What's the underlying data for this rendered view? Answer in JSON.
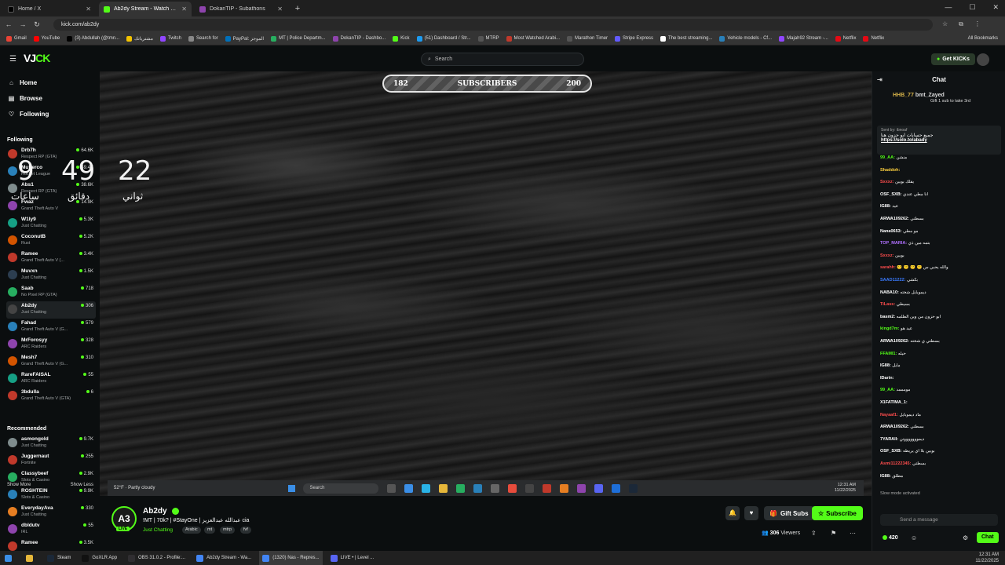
{
  "browser": {
    "tabs": [
      {
        "label": "Home / X",
        "color": "#000000"
      },
      {
        "label": "Ab2dy Stream - Watch Live on",
        "color": "#53fc18"
      },
      {
        "label": "DokanTIP - Subathons",
        "color": "#8e44ad"
      }
    ],
    "url": "kick.com/ab2dy",
    "bookmarks": [
      "Gmail",
      "YouTube",
      "(3) Abdullah (@tmn...",
      "مشترياتك",
      "Twitch",
      "Search for",
      "PayPal: الموجز",
      "MT | Police Departm...",
      "DokanTIP - Dashbo...",
      "Kick",
      "(51) Dashboard / Str...",
      "MTRP",
      "Most Watched Arabi...",
      "Marathon Timer",
      "Stripe Express",
      "The best streaming...",
      "Vehicle models - Cf...",
      "Majah92 Stream -...",
      "Netflix",
      "Netflix"
    ],
    "all_bookmarks": "All Bookmarks"
  },
  "header": {
    "search_placeholder": "Search",
    "get_kicks": "Get KICKs"
  },
  "sidebar": {
    "nav": [
      "Home",
      "Browse",
      "Following"
    ],
    "following_title": "Following",
    "following": [
      {
        "name": "Drb7h",
        "cat": "Respect RP (GTA)",
        "viewers": "64.6K",
        "color": "#c0392b"
      },
      {
        "name": "Mufierco",
        "cat": "Rocket League",
        "viewers": "49.4K",
        "color": "#2980b9"
      },
      {
        "name": "Abs1",
        "cat": "Respect RP (GTA)",
        "viewers": "38.6K",
        "color": "#7f8c8d"
      },
      {
        "name": "Fwaz",
        "cat": "Grand Theft Auto V",
        "viewers": "14.9K",
        "color": "#8e44ad"
      },
      {
        "name": "W1ly9",
        "cat": "Just Chatting",
        "viewers": "5.3K",
        "color": "#16a085"
      },
      {
        "name": "CoconutB",
        "cat": "Rust",
        "viewers": "5.2K",
        "color": "#d35400"
      },
      {
        "name": "Ramee",
        "cat": "Grand Theft Auto V (...",
        "viewers": "3.4K",
        "color": "#c0392b"
      },
      {
        "name": "Muvxn",
        "cat": "Just Chatting",
        "viewers": "1.5K",
        "color": "#2c3e50"
      },
      {
        "name": "Saab",
        "cat": "No Pixel RP (GTA)",
        "viewers": "718",
        "color": "#27ae60"
      },
      {
        "name": "Ab2dy",
        "cat": "Just Chatting",
        "viewers": "306",
        "color": "#444444"
      },
      {
        "name": "Fahad",
        "cat": "Grand Theft Auto V (G...",
        "viewers": "579",
        "color": "#2980b9"
      },
      {
        "name": "MrForosyy",
        "cat": "ARC Raiders",
        "viewers": "328",
        "color": "#8e44ad"
      },
      {
        "name": "Mesh7",
        "cat": "Grand Theft Auto V (G...",
        "viewers": "310",
        "color": "#d35400"
      },
      {
        "name": "RareFAISAL",
        "cat": "ARC Raiders",
        "viewers": "55",
        "color": "#16a085"
      },
      {
        "name": "3bdulla",
        "cat": "Grand Theft Auto V (GTA)",
        "viewers": "6",
        "color": "#c0392b"
      }
    ],
    "show_more": "Show More",
    "show_less": "Show Less",
    "recommended_title": "Recommended",
    "recommended": [
      {
        "name": "asmongold",
        "cat": "Just Chatting",
        "viewers": "9.7K",
        "color": "#7f8c8d"
      },
      {
        "name": "Juggernaut",
        "cat": "Fortnite",
        "viewers": "255",
        "color": "#c0392b"
      },
      {
        "name": "Classybeef",
        "cat": "Slots & Casino",
        "viewers": "2.9K",
        "color": "#27ae60"
      },
      {
        "name": "ROSHTEIN",
        "cat": "Slots & Casino",
        "viewers": "9.9K",
        "color": "#2980b9"
      },
      {
        "name": "EverydayAva",
        "cat": "Just Chatting",
        "viewers": "330",
        "color": "#e67e22"
      },
      {
        "name": "dbldutv",
        "cat": "IRL",
        "viewers": "55",
        "color": "#8e44ad"
      },
      {
        "name": "Ramee",
        "cat": "",
        "viewers": "3.5K",
        "color": "#c0392b"
      }
    ]
  },
  "stream": {
    "sub_goal": {
      "current": "182",
      "label": "SUBSCRIBERS",
      "target": "200",
      "progress": 0.91
    },
    "timer": {
      "hours": "9",
      "hours_label": "ساعات",
      "minutes": "49",
      "minutes_label": "دقائق",
      "seconds": "22",
      "seconds_label": "ثواني"
    },
    "weather": "Partly cloudy",
    "temp": "52°F",
    "embedded_search": "Search",
    "embedded_time": "12:31 AM",
    "embedded_date": "11/22/2025",
    "streamer": "Ab2dy",
    "title": "!MT | 70k? | #StayOne | عبدالله عبدالعزيز cia",
    "category": "Just Chatting",
    "tags": [
      "Arabic",
      "mt",
      "mtrp",
      "fvf"
    ],
    "live_label": "LIVE",
    "gift_subs": "Gift Subs",
    "subscribe": "Subscribe",
    "viewers": "306",
    "viewers_label": "Viewers"
  },
  "chat": {
    "title": "Chat",
    "top_gifter_1": "HHB_77",
    "top_gifter_2": "bmt_Zayed",
    "gift_note": "Gift 1 sub to take 3rd",
    "pinned_by": "Sent by: ibnoaf",
    "pinned_text": "جميع حسابات ابو حزون هنا",
    "pinned_link": "https://solo.to/abady",
    "messages": [
      {
        "u": "99_AA:",
        "t": "منشن",
        "c": "#53fc18"
      },
      {
        "u": "Shaddoh:",
        "t": "",
        "c": "#ffd23f"
      },
      {
        "u": "Sxxxz:",
        "t": "يقلك بوبين",
        "c": "#ff4d4d"
      },
      {
        "u": "OSF_SXB:",
        "t": "أنا مطي عندي",
        "c": "#ffffff"
      },
      {
        "u": "IG88:",
        "t": "عيد",
        "c": "#ffffff"
      },
      {
        "u": "ARWA109262:",
        "t": "بسطتي",
        "c": "#ffffff"
      },
      {
        "u": "Nana0653:",
        "t": "مو مطي",
        "c": "#ffffff"
      },
      {
        "u": "TOP_MARIA:",
        "t": "بتمه مين ذي",
        "c": "#b070ff"
      },
      {
        "u": "Sxxxz:",
        "t": "بوبين",
        "c": "#ff4d4d"
      },
      {
        "u": "sarahh:",
        "t": "🙂 🙂 🙂 🙂 والله يحبي س",
        "c": "#ff4d4d"
      },
      {
        "u": "SAAD11222:",
        "t": "بكشي",
        "c": "#3a7bff"
      },
      {
        "u": "NABA10:",
        "t": "ديموبايل شخته",
        "c": "#ffffff"
      },
      {
        "u": "TiLass:",
        "t": "بسيطي",
        "c": "#ff4d4d"
      },
      {
        "u": "basm2:",
        "t": "ابو حزون من وين الظلمه",
        "c": "#ffffff"
      },
      {
        "u": "kingd7m:",
        "t": "عيد هو",
        "c": "#53fc18"
      },
      {
        "u": "ARWA109262:",
        "t": "بسطتي ي شخته",
        "c": "#ffffff"
      },
      {
        "u": "FFAMI1:",
        "t": "حيله",
        "c": "#53fc18"
      },
      {
        "u": "IG88:",
        "t": "مايل",
        "c": "#ffffff"
      },
      {
        "u": "IDarin:",
        "t": "",
        "c": "#ffffff"
      },
      {
        "u": "99_AA:",
        "t": "مومممد",
        "c": "#53fc18"
      },
      {
        "u": "X1FATIMA_1:",
        "t": "",
        "c": "#ffffff"
      },
      {
        "u": "Nayaaf1:",
        "t": "ماد ديموبايل",
        "c": "#ff4d4d"
      },
      {
        "u": "ARWA109262:",
        "t": "بسطتي",
        "c": "#ffffff"
      },
      {
        "u": "7YARAII:",
        "t": "ديمووووووونن",
        "c": "#ffffff"
      },
      {
        "u": "OSF_SXB:",
        "t": "بوبين بلا اي يريطه",
        "c": "#ffffff"
      },
      {
        "u": "Asmi11222345:",
        "t": "بسطتي",
        "c": "#ff4d4d"
      },
      {
        "u": "IG88:",
        "t": "مطلق",
        "c": "#ffffff"
      }
    ],
    "slow_mode": "Slow mode activated",
    "input_placeholder": "Send a message",
    "kicks_count": "420",
    "send_label": "Chat"
  },
  "taskbar": {
    "apps": [
      "Steam",
      "GoXLR App",
      "OBS 31.0.2 - Profile:...",
      "Ab2dy Stream - Wa...",
      "(1320) Nas - Repres...",
      "LIVE • | Level ..."
    ],
    "time": "12:31 AM",
    "date": "11/22/2025"
  }
}
